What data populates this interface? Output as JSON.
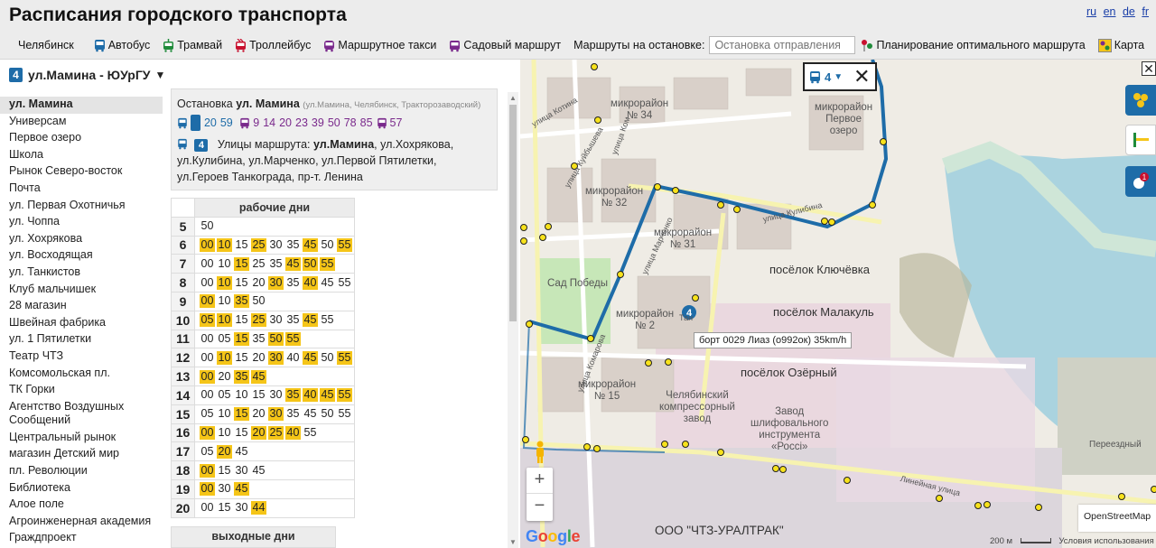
{
  "header": {
    "title": "Расписания городского транспорта",
    "languages": [
      "ru",
      "en",
      "de",
      "fr"
    ]
  },
  "nav": {
    "city": "Челябинск",
    "bus": "Автобус",
    "tram": "Трамвай",
    "trolleybus": "Троллейбус",
    "minibus": "Маршрутное такси",
    "garden": "Садовый маршрут",
    "stop_routes_label": "Маршруты на остановке:",
    "stop_placeholder": "Остановка отправления",
    "planner": "Планирование оптимального маршрута",
    "map": "Карта"
  },
  "route": {
    "number": "4",
    "name": "ул.Мамина - ЮУрГУ",
    "caret": "▼"
  },
  "stops": [
    "ул. Мамина",
    "Универсам",
    "Первое озеро",
    "Школа",
    "Рынок Северо-восток",
    "Почта",
    "ул. Первая Охотничья",
    "ул. Чоппа",
    "ул. Хохрякова",
    "ул. Восходящая",
    "ул. Танкистов",
    "Клуб мальчишек",
    "28 магазин",
    "Швейная фабрика",
    "ул. 1 Пятилетки",
    "Театр ЧТЗ",
    "Комсомольская пл.",
    "ТК Горки",
    "Агентство Воздушных Сообщений",
    "Центральный рынок",
    "магазин Детский мир",
    "пл. Революции",
    "Библиотека",
    "Алое поле",
    "Агроинженерная академия",
    "Граждпроект"
  ],
  "stop_info": {
    "prefix": "Остановка",
    "name": "ул. Мамина",
    "address": "(ул.Мамина, Челябинск, Тракторозаводский)",
    "bus_lines": [
      "4",
      "20",
      "59"
    ],
    "minibus_lines": [
      "9",
      "14",
      "20",
      "23",
      "39",
      "50",
      "78",
      "85"
    ],
    "garden_lines": [
      "57"
    ],
    "streets_label": "Улицы маршрута:",
    "streets_first": "ул.Мамина",
    "streets_rest": ", ул.Хохрякова, ул.Кулибина, ул.Марченко, ул.Первой Пятилетки, ул.Героев Танкограда, пр-т. Ленина"
  },
  "timetable": {
    "weekday_header": "рабочие дни",
    "weekend_header": "выходные дни",
    "rows": [
      {
        "hour": "5",
        "mins": [
          [
            "50",
            0
          ]
        ]
      },
      {
        "hour": "6",
        "mins": [
          [
            "00",
            1
          ],
          [
            "10",
            1
          ],
          [
            "15",
            0
          ],
          [
            "25",
            1
          ],
          [
            "30",
            0
          ],
          [
            "35",
            0
          ],
          [
            "45",
            1
          ],
          [
            "50",
            0
          ],
          [
            "55",
            1
          ]
        ]
      },
      {
        "hour": "7",
        "mins": [
          [
            "00",
            0
          ],
          [
            "10",
            0
          ],
          [
            "15",
            1
          ],
          [
            "25",
            0
          ],
          [
            "35",
            0
          ],
          [
            "45",
            1
          ],
          [
            "50",
            1
          ],
          [
            "55",
            1
          ]
        ]
      },
      {
        "hour": "8",
        "mins": [
          [
            "00",
            0
          ],
          [
            "10",
            1
          ],
          [
            "15",
            0
          ],
          [
            "20",
            0
          ],
          [
            "30",
            1
          ],
          [
            "35",
            0
          ],
          [
            "40",
            1
          ],
          [
            "45",
            0
          ],
          [
            "55",
            0
          ]
        ]
      },
      {
        "hour": "9",
        "mins": [
          [
            "00",
            1
          ],
          [
            "10",
            0
          ],
          [
            "35",
            1
          ],
          [
            "50",
            0
          ]
        ]
      },
      {
        "hour": "10",
        "mins": [
          [
            "05",
            1
          ],
          [
            "10",
            1
          ],
          [
            "15",
            0
          ],
          [
            "25",
            1
          ],
          [
            "30",
            0
          ],
          [
            "35",
            0
          ],
          [
            "45",
            1
          ],
          [
            "55",
            0
          ]
        ]
      },
      {
        "hour": "11",
        "mins": [
          [
            "00",
            0
          ],
          [
            "05",
            0
          ],
          [
            "15",
            1
          ],
          [
            "35",
            0
          ],
          [
            "50",
            1
          ],
          [
            "55",
            1
          ]
        ]
      },
      {
        "hour": "12",
        "mins": [
          [
            "00",
            0
          ],
          [
            "10",
            1
          ],
          [
            "15",
            0
          ],
          [
            "20",
            0
          ],
          [
            "30",
            1
          ],
          [
            "40",
            0
          ],
          [
            "45",
            1
          ],
          [
            "50",
            0
          ],
          [
            "55",
            1
          ]
        ]
      },
      {
        "hour": "13",
        "mins": [
          [
            "00",
            1
          ],
          [
            "20",
            0
          ],
          [
            "35",
            1
          ],
          [
            "45",
            1
          ]
        ]
      },
      {
        "hour": "14",
        "mins": [
          [
            "00",
            0
          ],
          [
            "05",
            0
          ],
          [
            "10",
            0
          ],
          [
            "15",
            0
          ],
          [
            "30",
            0
          ],
          [
            "35",
            1
          ],
          [
            "40",
            1
          ],
          [
            "45",
            1
          ],
          [
            "55",
            1
          ]
        ]
      },
      {
        "hour": "15",
        "mins": [
          [
            "05",
            0
          ],
          [
            "10",
            0
          ],
          [
            "15",
            1
          ],
          [
            "20",
            0
          ],
          [
            "30",
            1
          ],
          [
            "35",
            0
          ],
          [
            "45",
            0
          ],
          [
            "50",
            0
          ],
          [
            "55",
            0
          ]
        ]
      },
      {
        "hour": "16",
        "mins": [
          [
            "00",
            1
          ],
          [
            "10",
            0
          ],
          [
            "15",
            0
          ],
          [
            "20",
            1
          ],
          [
            "25",
            1
          ],
          [
            "40",
            1
          ],
          [
            "55",
            0
          ]
        ]
      },
      {
        "hour": "17",
        "mins": [
          [
            "05",
            0
          ],
          [
            "20",
            1
          ],
          [
            "45",
            0
          ]
        ]
      },
      {
        "hour": "18",
        "mins": [
          [
            "00",
            1
          ],
          [
            "15",
            0
          ],
          [
            "30",
            0
          ],
          [
            "45",
            0
          ]
        ]
      },
      {
        "hour": "19",
        "mins": [
          [
            "00",
            1
          ],
          [
            "30",
            0
          ],
          [
            "45",
            1
          ]
        ]
      },
      {
        "hour": "20",
        "mins": [
          [
            "00",
            0
          ],
          [
            "15",
            0
          ],
          [
            "30",
            0
          ],
          [
            "44",
            1
          ]
        ]
      }
    ]
  },
  "map": {
    "route_value": "4",
    "close_x": "✕",
    "vehicle_tooltip": "борт 0029 Лиаз (о992ок) 35km/h",
    "zoom_in": "+",
    "zoom_out": "−",
    "google": "Google",
    "attribution": "OpenStreetMap",
    "scale": "200 м",
    "terms": "Условия использования",
    "labels": {
      "district_34": "микрорайон\n№ 34",
      "district_32": "микрорайон\n№ 32",
      "district_31": "микрорайон\n№ 31",
      "district_2": "микрорайон\n№ 2",
      "district_15": "микрорайон\n№ 15",
      "pervoe_ozero": "микрорайон\nПервое\nозеро",
      "klyuchevka": "посёлок Ключёвка",
      "malakul": "посёлок Малакуль",
      "ozerny": "посёлок Озёрный",
      "sad_pobedy": "Сад Победы",
      "kompressor": "Челябинский\nкомпрессорный\nзавод",
      "zavod_instr": "Завод\nшлифовального\nинструмента\n«Россі»",
      "chtz": "ООО \"ЧТЗ-УРАЛТРАК\"",
      "pereezdny": "Переездный",
      "ul_kotina": "улица Котина",
      "ul_kuibysheva": "улица Куйбышева",
      "ul_kulibina": "улица Кулибина",
      "ul_marchenko": "улица Марченко",
      "ul_komarova": "улица Комарова",
      "ul_lineynaya": "Линейная улица",
      "ul_kom": "улица Ком",
      "tank_label": "Тан"
    },
    "colors": {
      "route": "#1e6ca8",
      "stop": "#f7e21c",
      "badge": "#1e6ca8"
    }
  }
}
